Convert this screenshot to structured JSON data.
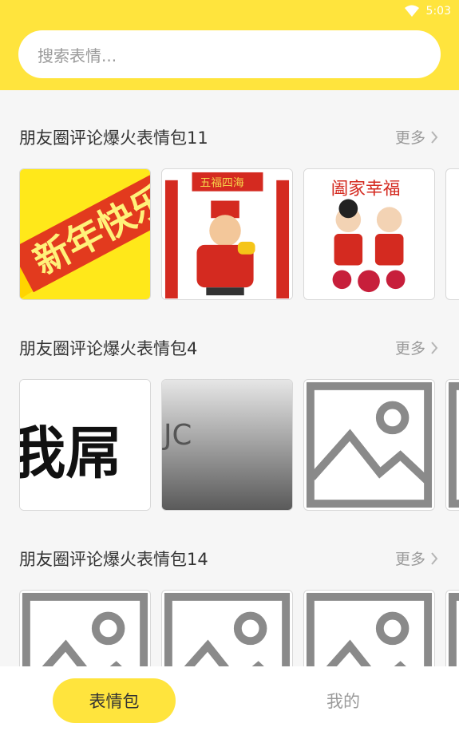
{
  "status_bar": {
    "time": "5:03",
    "wifi_icon": "wifi-icon"
  },
  "search": {
    "placeholder": "搜索表情..."
  },
  "sections": [
    {
      "title": "朋友圈评论爆火表情包11",
      "more_label": "更多",
      "thumbnails": [
        {
          "kind": "image",
          "text": "新年快乐"
        },
        {
          "kind": "image",
          "text": "五福四海"
        },
        {
          "kind": "image",
          "text": "阖家幸福"
        },
        {
          "kind": "partial"
        }
      ]
    },
    {
      "title": "朋友圈评论爆火表情包4",
      "more_label": "更多",
      "thumbnails": [
        {
          "kind": "image",
          "text": "我屌"
        },
        {
          "kind": "image",
          "text": "JC"
        },
        {
          "kind": "placeholder"
        },
        {
          "kind": "partial"
        }
      ]
    },
    {
      "title": "朋友圈评论爆火表情包14",
      "more_label": "更多",
      "thumbnails": [
        {
          "kind": "placeholder"
        },
        {
          "kind": "placeholder"
        },
        {
          "kind": "placeholder"
        },
        {
          "kind": "partial"
        }
      ]
    }
  ],
  "bottom_nav": {
    "active_tab": "表情包",
    "other_tab": "我的"
  },
  "colors": {
    "accent": "#ffe43d",
    "text": "#333333",
    "muted": "#9a9a9a",
    "bg": "#f6f6f6"
  }
}
